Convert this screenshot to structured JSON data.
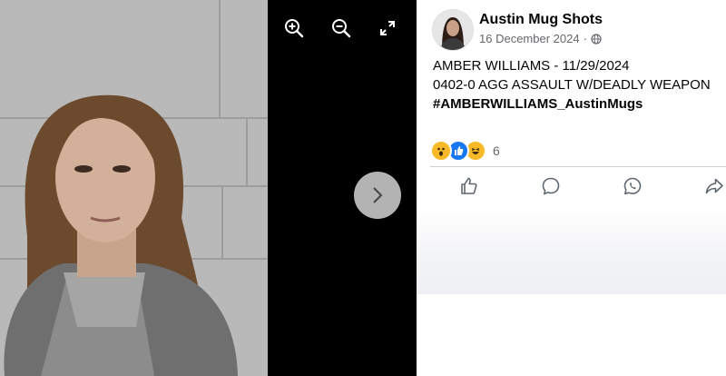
{
  "viewer": {
    "zoom_in_icon": "zoom-in-icon",
    "zoom_out_icon": "zoom-out-icon",
    "fullscreen_icon": "expand-icon",
    "next_icon": "chevron-right-icon"
  },
  "post": {
    "page_name": "Austin Mug Shots",
    "date": "16 December 2024",
    "separator": "·",
    "privacy_icon": "globe-icon",
    "line1": "AMBER WILLIAMS - 11/29/2024",
    "line2": "0402-0 AGG ASSAULT W/DEADLY WEAPON",
    "hashtag": "#AMBERWILLIAMS_AustinMugs",
    "reaction_count": "6",
    "reactions": [
      "wow",
      "like",
      "haha"
    ],
    "actions": [
      "like",
      "comment",
      "whatsapp-share",
      "share"
    ]
  },
  "colors": {
    "accent": "#1877f2",
    "text": "#050505",
    "secondary": "#65676b",
    "reaction_yellow": "#f7b928"
  }
}
